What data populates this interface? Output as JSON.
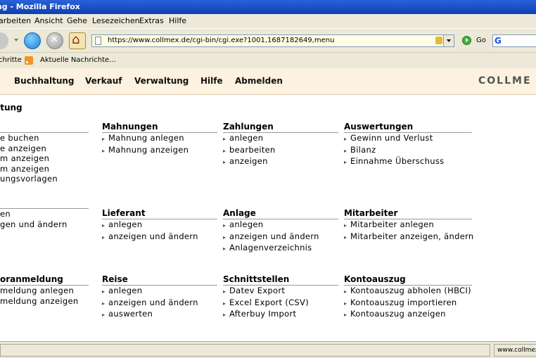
{
  "window": {
    "title": "ltung - Mozilla Firefox"
  },
  "menubar": [
    {
      "label": "arbeiten"
    },
    {
      "label": "Ansicht"
    },
    {
      "label": "Gehe"
    },
    {
      "label": "Lesezeichen"
    },
    {
      "label": "Extras"
    },
    {
      "label": "Hilfe"
    }
  ],
  "toolbar": {
    "url": "https://www.collmex.de/cgi-bin/cgi.exe?1001,1687182649,menu",
    "go_label": "Go"
  },
  "bookmarks": {
    "item1": "chritte",
    "item2": "Aktuelle Nachrichte..."
  },
  "appnav": {
    "items": [
      "Buchhaltung",
      "Verkauf",
      "Verwaltung",
      "Hilfe",
      "Abmelden"
    ],
    "brand": "COLLME"
  },
  "page": {
    "title": "altung"
  },
  "sections": [
    {
      "title": "e",
      "items": [
        "e buchen",
        "e anzeigen",
        "m anzeigen",
        "m anzeigen",
        "ungsvorlagen"
      ],
      "bullets": false
    },
    {
      "title": "Mahnungen",
      "items": [
        "Mahnung anlegen",
        "Mahnung anzeigen"
      ],
      "bullets": true
    },
    {
      "title": "Zahlungen",
      "items": [
        "anlegen",
        "bearbeiten",
        "anzeigen"
      ],
      "bullets": true
    },
    {
      "title": "Auswertungen",
      "items": [
        "Gewinn und Verlust",
        "Bilanz",
        "Einnahme Überschuss"
      ],
      "bullets": true
    },
    {
      "title": "",
      "items": [
        "en",
        "gen und ändern"
      ],
      "bullets": false
    },
    {
      "title": "Lieferant",
      "items": [
        "anlegen",
        "anzeigen und ändern"
      ],
      "bullets": true
    },
    {
      "title": "Anlage",
      "items": [
        "anlegen",
        "anzeigen und ändern",
        "Anlagenverzeichnis"
      ],
      "bullets": true
    },
    {
      "title": "Mitarbeiter",
      "items": [
        "Mitarbeiter anlegen",
        "Mitarbeiter anzeigen, ändern"
      ],
      "bullets": true
    },
    {
      "title": "oranmeldung",
      "items": [
        "meldung anlegen",
        "meldung anzeigen"
      ],
      "bullets": false
    },
    {
      "title": "Reise",
      "items": [
        "anlegen",
        "anzeigen und ändern",
        "auswerten"
      ],
      "bullets": true
    },
    {
      "title": "Schnittstellen",
      "items": [
        "Datev Export",
        "Excel Export (CSV)",
        "Afterbuy Import"
      ],
      "bullets": true
    },
    {
      "title": "Kontoauszug",
      "items": [
        "Kontoauszug abholen (HBCI)",
        "Kontoauszug importieren",
        "Kontoauszug anzeigen"
      ],
      "bullets": true
    }
  ],
  "statusbar": {
    "url": "www.collmex.de"
  }
}
